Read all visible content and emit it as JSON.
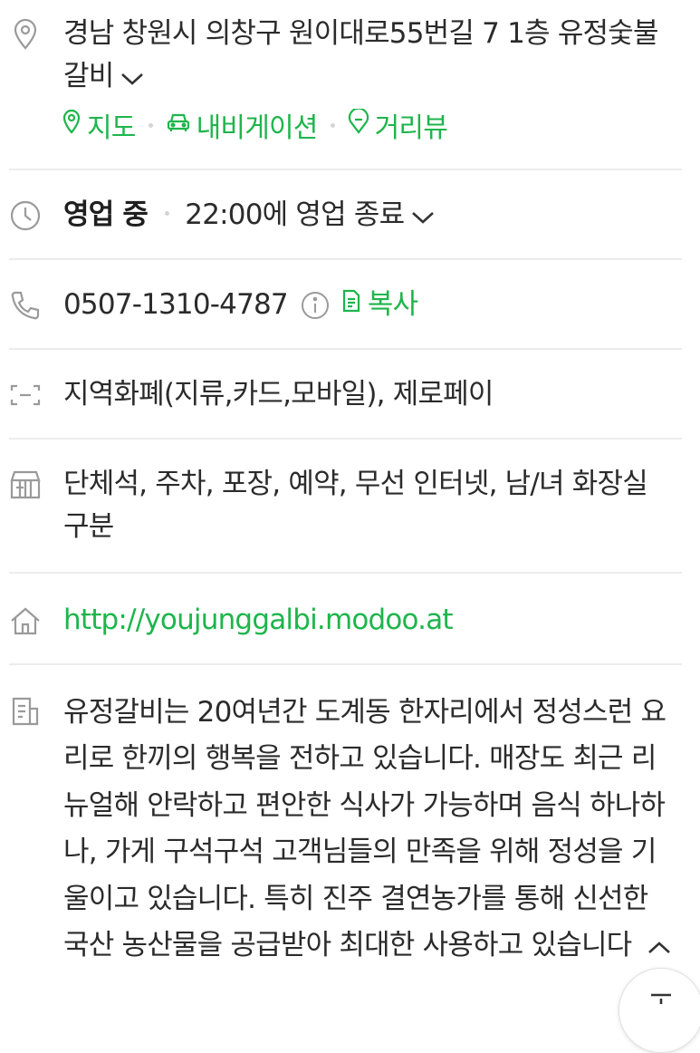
{
  "address": {
    "text": "경남 창원시 의창구 원이대로55번길 7 1층 유정숯불갈비",
    "expand_icon": "chevron-down-icon",
    "links": [
      {
        "label": "지도",
        "icon": "map-pin-icon"
      },
      {
        "label": "내비게이션",
        "icon": "car-icon"
      },
      {
        "label": "거리뷰",
        "icon": "street-view-icon"
      }
    ]
  },
  "hours": {
    "status": "영업 중",
    "detail": "22:00에 영업 종료"
  },
  "phone": {
    "number": "0507-1310-4787",
    "copy_label": "복사"
  },
  "payment": {
    "text": "지역화폐(지류,카드,모바일), 제로페이"
  },
  "amenities": {
    "text": "단체석, 주차, 포장, 예약, 무선 인터넷, 남/녀 화장실 구분"
  },
  "website": {
    "url": "http://youjunggalbi.modoo.at"
  },
  "description": {
    "text": "유정갈비는 20여년간 도계동 한자리에서 정성스런 요리로 한끼의 행복을 전하고 있습니다. 매장도 최근 리뉴얼해 안락하고 편안한 식사가 가능하며 음식 하나하나, 가게 구석구석 고객님들의 만족을 위해 정성을 기울이고 있습니다. 특히 진주 결연농가를 통해 신선한 국산 농산물을 공급받아 최대한 사용하고 있습니다",
    "collapse_icon": "chevron-up-icon"
  },
  "colors": {
    "accent_green": "#1eb54b",
    "text": "#2b2b2b",
    "icon_gray": "#9a9a9a",
    "divider": "#ececec"
  }
}
